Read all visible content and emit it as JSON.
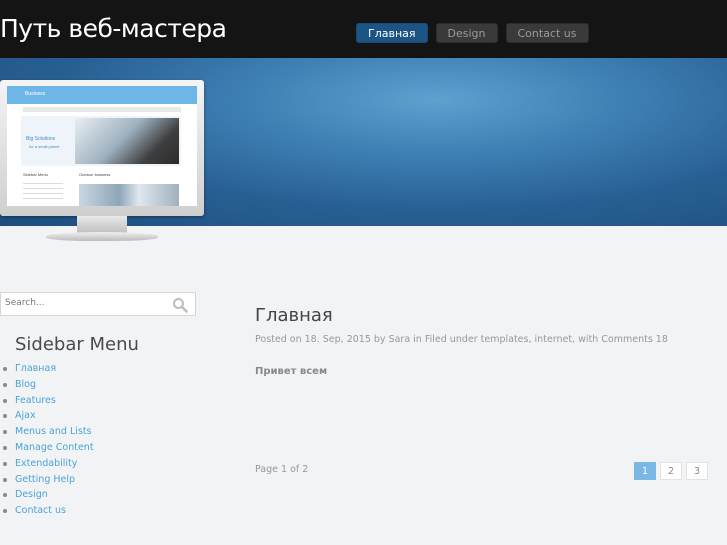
{
  "header": {
    "site_title": "Путь веб-мастера",
    "nav": [
      {
        "label": "Главная",
        "active": true
      },
      {
        "label": "Design",
        "active": false
      },
      {
        "label": "Contact us",
        "active": false
      }
    ]
  },
  "banner": {
    "screen": {
      "brand": "Business",
      "hero_title": "Big Solutions",
      "hero_subtitle": "for a small planet",
      "col1_title": "Sidebar Menu",
      "col2_title": "Outdoor business"
    }
  },
  "sidebar": {
    "search_placeholder": "Search...",
    "search_icon": "search-icon",
    "title": "Sidebar Menu",
    "items": [
      "Главная",
      "Blog",
      "Features",
      "Ajax",
      "Menus and Lists",
      "Manage Content",
      "Extendability",
      "Getting Help",
      "Design",
      "Contact us"
    ]
  },
  "post": {
    "title": "Главная",
    "meta": "Posted on 18. Sep, 2015 by Sara in Filed under templates, internet, with Comments 18",
    "body": "Привет всем"
  },
  "pagination": {
    "info": "Page 1 of 2",
    "pages": [
      "1",
      "2",
      "3"
    ],
    "current": "1"
  },
  "colors": {
    "header_bg": "#141414",
    "nav_active": "#1c5585",
    "link": "#4aa3d8",
    "banner_blue": "#285f93",
    "page_active": "#7bb8e6"
  }
}
